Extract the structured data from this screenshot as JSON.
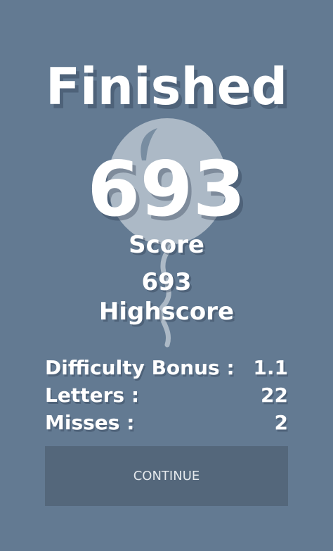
{
  "title": "Finished",
  "score": {
    "value": "693",
    "label": "Score"
  },
  "highscore": {
    "value": "693",
    "label": "Highscore"
  },
  "stats": [
    {
      "label": "Difficulty Bonus :",
      "value": "1.1"
    },
    {
      "label": "Letters :",
      "value": "22"
    },
    {
      "label": "Misses :",
      "value": "2"
    }
  ],
  "continue_label": "CONTINUE",
  "colors": {
    "background": "#637a92",
    "button": "#54677b",
    "balloon": "#b9c4cf"
  },
  "icons": {
    "background_art": "balloon-icon"
  }
}
